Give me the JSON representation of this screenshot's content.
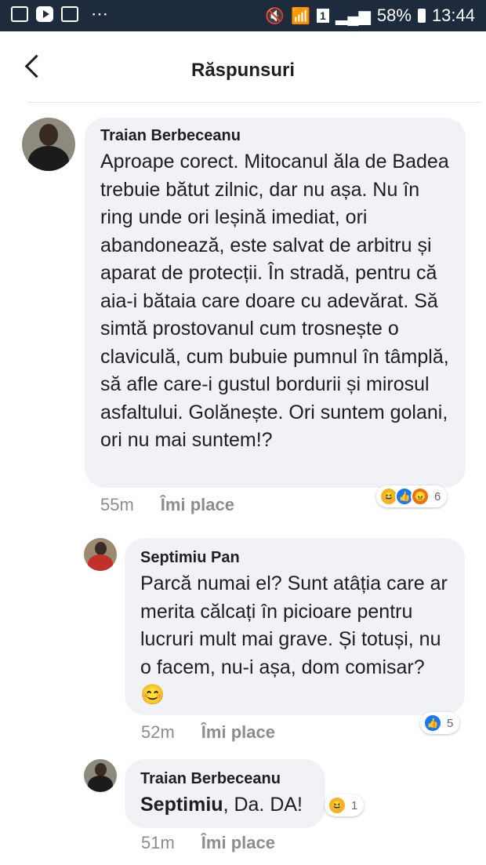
{
  "status_bar": {
    "battery": "58%",
    "time": "13:44",
    "sim": "1",
    "dots": "⋯"
  },
  "header": {
    "title": "Răspunsuri"
  },
  "comments": [
    {
      "author": "Traian Berbeceanu",
      "text": "Aproape corect. Mitocanul ăla de Badea trebuie bătut zilnic, dar nu așa. Nu în ring unde ori leșină imediat, ori abandonează, este salvat de arbitru și aparat de protecții. În stradă, pentru că aia-i bătaia care doare cu adevărat. Să simtă prostovanul cum trosnește o claviculă, cum bubuie pumnul în tâmplă, să afle care-i gustul bordurii și mirosul asfaltului. Golănește. Ori suntem golani, ori nu mai suntem!?",
      "time": "55m",
      "like_label": "Îmi place",
      "reactions": [
        "haha",
        "like",
        "angry"
      ],
      "reaction_count": "6"
    },
    {
      "author": "Septimiu Pan",
      "text": "Parcă numai el? Sunt atâția care ar merita călcați în picioare pentru lucruri mult mai grave. Și totuși, nu o facem, nu-i așa, dom comisar? 😊",
      "time": "52m",
      "like_label": "Îmi place",
      "reactions": [
        "like"
      ],
      "reaction_count": "5"
    },
    {
      "author": "Traian Berbeceanu",
      "mention": "Septimiu",
      "text": ", Da. DA!",
      "time": "51m",
      "like_label": "Îmi place",
      "reactions": [
        "haha"
      ],
      "reaction_count": "1"
    }
  ],
  "colors": {
    "status_bar": "#1d2b3c",
    "bubble": "#f0f2f5",
    "like": "#1877f2",
    "haha": "#f7b125",
    "angry": "#e9710f"
  }
}
